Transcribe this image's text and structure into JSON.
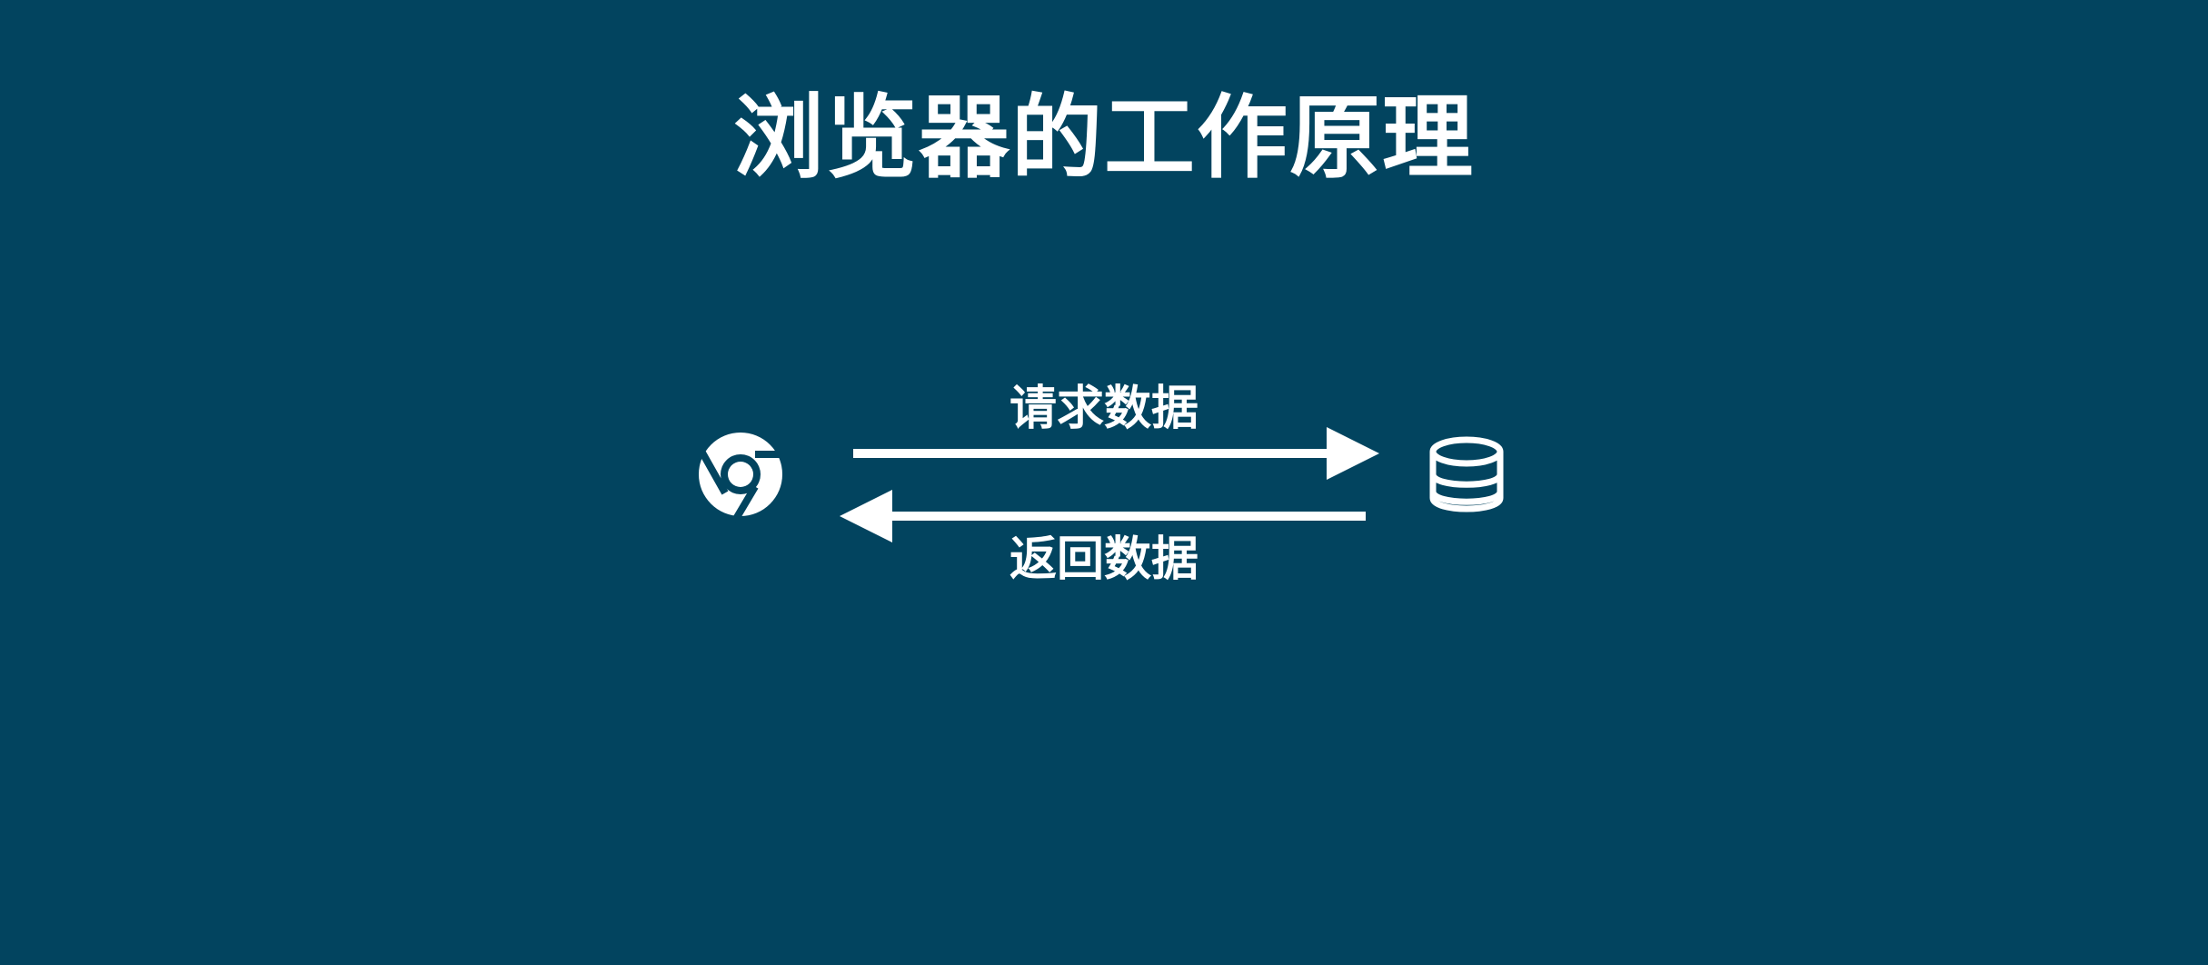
{
  "slide": {
    "title": "浏览器的工作原理",
    "background_color": "#02445f",
    "foreground_color": "#ffffff"
  },
  "diagram": {
    "client_icon": "chrome-browser-icon",
    "server_icon": "database-icon",
    "request_label": "请求数据",
    "response_label": "返回数据"
  }
}
